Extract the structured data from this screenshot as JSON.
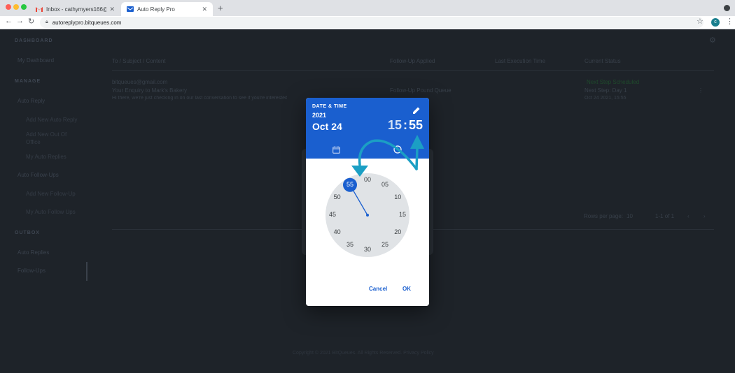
{
  "browser": {
    "tabs": [
      {
        "label": "Inbox - cathymyers166@gmail.",
        "active": false
      },
      {
        "label": "Auto Reply Pro",
        "active": true
      }
    ],
    "url": "autoreplypro.bitqueues.com",
    "profile_initial": "c"
  },
  "sidebar": {
    "dashboard_heading": "DASHBOARD",
    "dashboard_item": "My Dashboard",
    "manage_heading": "MANAGE",
    "auto_reply_group": "Auto Reply",
    "auto_reply_items": [
      "Add New Auto Reply",
      "Add New Out Of",
      "Office",
      "My Auto Replies"
    ],
    "auto_followup_group": "Auto Follow-Ups",
    "auto_followup_items": [
      "Add New Follow-Up",
      "My Auto Follow Ups"
    ],
    "outbox_heading": "OUTBOX",
    "outbox_items": [
      "Auto Replies",
      "Follow-Ups"
    ]
  },
  "table": {
    "columns": [
      "To / Subject / Content",
      "Follow-Up Applied",
      "Last Execution Time",
      "Current Status"
    ],
    "row": {
      "to": "bitqueues@gmail.com",
      "subject": "Your Enquiry to Mark's Bakery",
      "content": "Hi there, we're just checking in on our last conversation to see if you're interested in",
      "followup": "Follow-Up Pound Queue",
      "status": "Next Step Scheduled",
      "next_step": "Next Step: Day 1",
      "next_time": "Oct 24 2021, 15:55"
    },
    "rows_per_page_label": "Rows per page:",
    "rows_per_page_value": "10",
    "pagination": "1-1 of 1"
  },
  "footer": {
    "text": "Copyright © 2021 BitQueues. All Rights Reserved.",
    "link": "Privacy Policy"
  },
  "picker": {
    "label": "DATE & TIME",
    "year": "2021",
    "date": "Oct 24",
    "hour": "15",
    "minute": "55",
    "minute_value": 55,
    "dial_numbers": [
      "00",
      "05",
      "10",
      "15",
      "20",
      "25",
      "30",
      "35",
      "40",
      "45",
      "50",
      "55"
    ],
    "cancel_label": "Cancel",
    "ok_label": "OK"
  },
  "colors": {
    "accent": "#1a5fcf",
    "annotation": "#1b9fc4"
  },
  "icons": {
    "edit": "pencil-icon",
    "date_tab": "calendar-icon",
    "time_tab": "clock-icon"
  }
}
